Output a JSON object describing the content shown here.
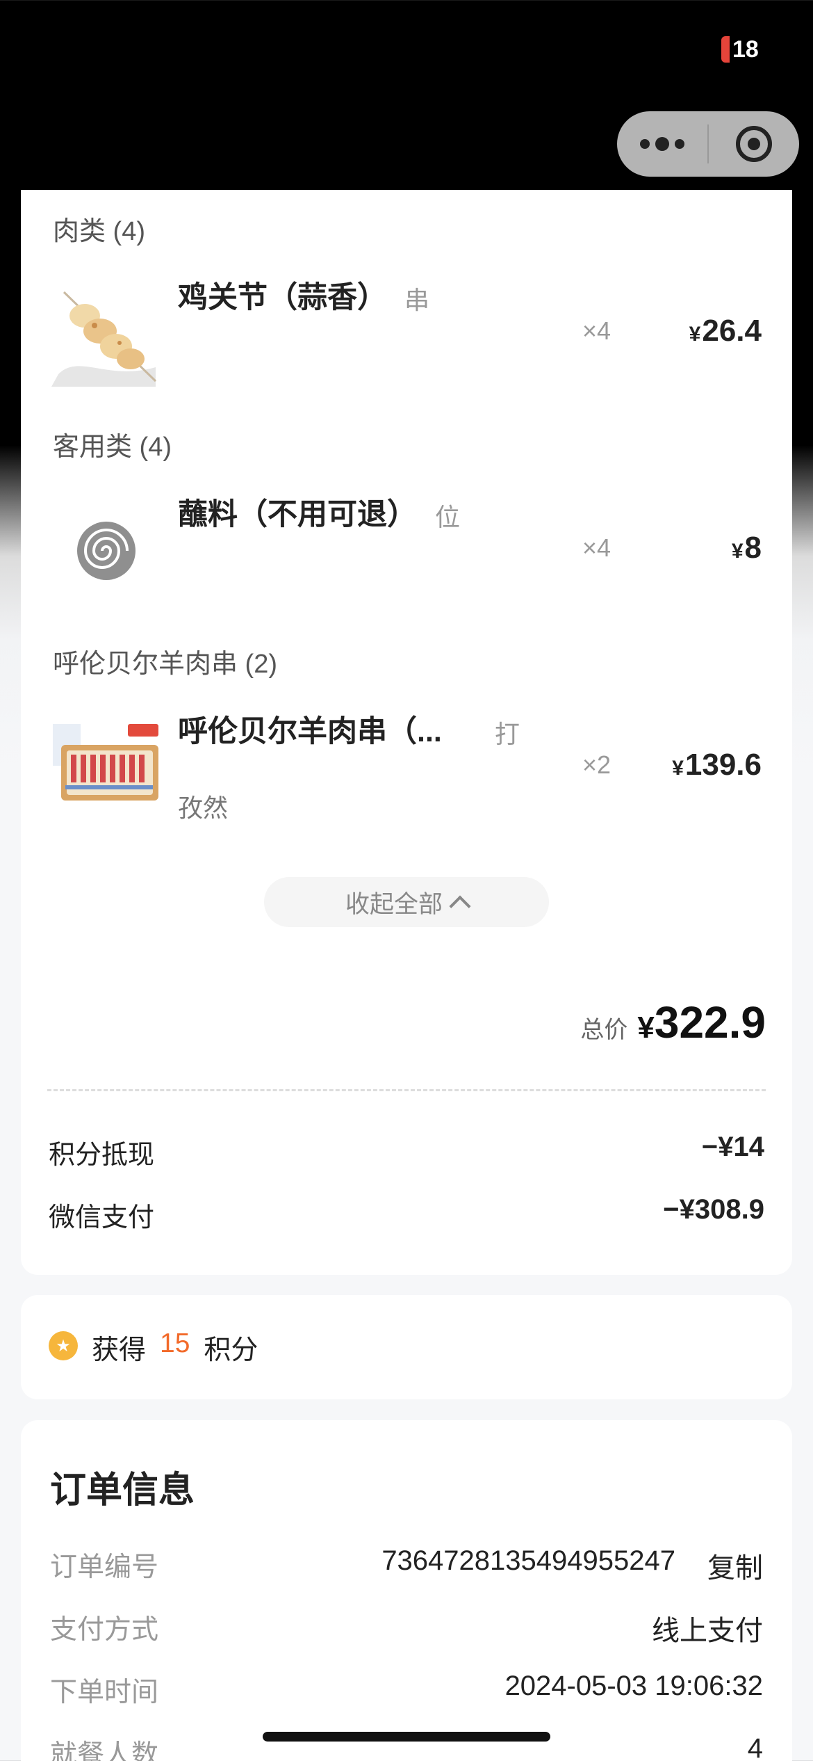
{
  "status_bar": {
    "battery_text": "18",
    "battery_color": "#e5443a"
  },
  "capsule": {
    "more_icon": "more-dots-icon",
    "close_icon": "target-circle-icon"
  },
  "categories": [
    {
      "title": "肉类 (4)",
      "item": {
        "name": "鸡关节（蒜香）",
        "unit": "串",
        "note": "",
        "qty": "×4",
        "yen": "¥",
        "price": "26.4",
        "image": "chicken-skewer-image"
      }
    },
    {
      "title": "客用类 (4)",
      "item": {
        "name": "蘸料（不用可退）",
        "unit": "位",
        "note": "",
        "qty": "×4",
        "yen": "¥",
        "price": "8",
        "image": "sauce-swirl-image"
      }
    },
    {
      "title": "呼伦贝尔羊肉串 (2)",
      "item": {
        "name": "呼伦贝尔羊肉串（...",
        "unit": "打",
        "note": "孜然",
        "qty": "×2",
        "yen": "¥",
        "price": "139.6",
        "image": "lamb-skewer-tray-image"
      }
    }
  ],
  "collapse_button": {
    "label": "收起全部"
  },
  "total": {
    "label": "总价",
    "yen": "¥",
    "value": "322.9"
  },
  "payments": [
    {
      "label": "积分抵现",
      "value": "−¥14"
    },
    {
      "label": "微信支付",
      "value": "−¥308.9"
    }
  ],
  "points": {
    "prefix": "获得",
    "amount": "15",
    "suffix": "积分",
    "accent": "#f26a2a"
  },
  "order_info": {
    "title": "订单信息",
    "rows": [
      {
        "label": "订单编号",
        "value": "7364728135494955247"
      },
      {
        "label": "支付方式",
        "value": "线上支付"
      },
      {
        "label": "下单时间",
        "value": "2024-05-03 19:06:32"
      },
      {
        "label": "就餐人数",
        "value": "4"
      }
    ],
    "copy_label": "复制"
  }
}
